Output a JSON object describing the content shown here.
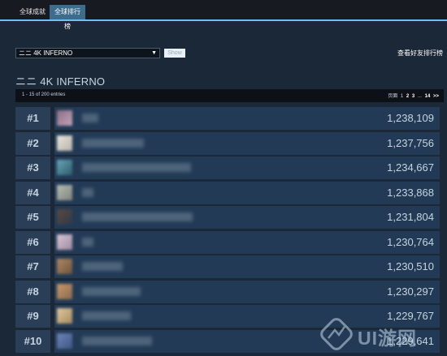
{
  "tabs": [
    {
      "label": "全球成就",
      "active": false
    },
    {
      "label": "全球排行榜",
      "active": true
    }
  ],
  "controls": {
    "selected_leaderboard": "ニニ 4K INFERNO",
    "show_button": "Show",
    "friends_link": "查看好友排行榜"
  },
  "leaderboard_title": "ニニ 4K INFERNO",
  "pager": {
    "entries_text": "1 - 15 of 200 entries",
    "prefix": "页面",
    "current": "1",
    "pages": [
      "2",
      "3"
    ],
    "ellipsis": "...",
    "last": "14",
    "next": ">>"
  },
  "rows": [
    {
      "rank": "#1",
      "score": "1,238,109"
    },
    {
      "rank": "#2",
      "score": "1,237,756"
    },
    {
      "rank": "#3",
      "score": "1,234,667"
    },
    {
      "rank": "#4",
      "score": "1,233,868"
    },
    {
      "rank": "#5",
      "score": "1,231,804"
    },
    {
      "rank": "#6",
      "score": "1,230,764"
    },
    {
      "rank": "#7",
      "score": "1,230,510"
    },
    {
      "rank": "#8",
      "score": "1,230,297"
    },
    {
      "rank": "#9",
      "score": "1,229,767"
    },
    {
      "rank": "#10",
      "score": "1,229,641"
    }
  ],
  "watermark": "UI游网",
  "colors": {
    "background": "#1b2838",
    "accent": "#67c1f5",
    "rank_cell": "#2a3f57",
    "player_cell": "#223a55",
    "active_tab": "#3d6c8d"
  }
}
